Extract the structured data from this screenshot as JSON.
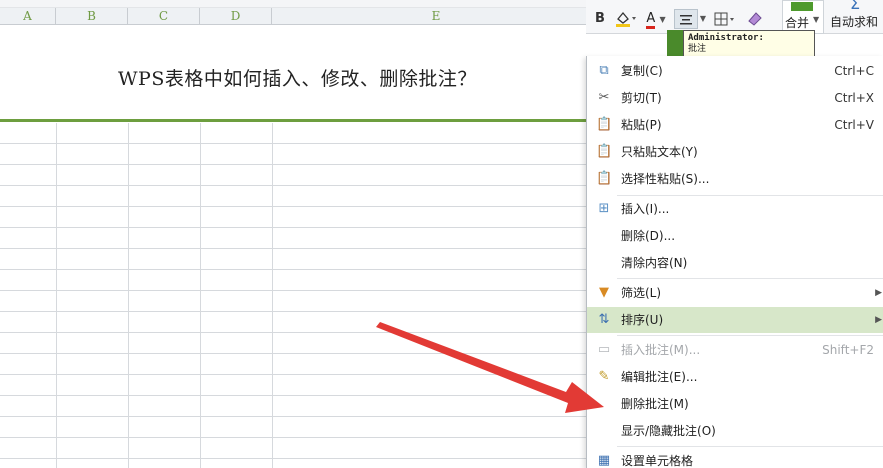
{
  "columns": [
    "A",
    "B",
    "C",
    "D",
    "E"
  ],
  "title": "WPS表格中如何插入、修改、删除批注？",
  "toolbar": {
    "bold": "B",
    "fill_icon": "fill-color-icon",
    "font_color": "A",
    "merge_label": "合并",
    "autosum_label": "自动求和"
  },
  "comment": {
    "author": "Administrator:",
    "text": "批注"
  },
  "menu": {
    "copy": {
      "label": "复制(C)",
      "shortcut": "Ctrl+C"
    },
    "cut": {
      "label": "剪切(T)",
      "shortcut": "Ctrl+X"
    },
    "paste": {
      "label": "粘贴(P)",
      "shortcut": "Ctrl+V"
    },
    "paste_text": {
      "label": "只粘贴文本(Y)"
    },
    "paste_special": {
      "label": "选择性粘贴(S)..."
    },
    "insert": {
      "label": "插入(I)..."
    },
    "delete": {
      "label": "删除(D)..."
    },
    "clear": {
      "label": "清除内容(N)"
    },
    "filter": {
      "label": "筛选(L)"
    },
    "sort": {
      "label": "排序(U)"
    },
    "insert_comment": {
      "label": "插入批注(M)...",
      "shortcut": "Shift+F2"
    },
    "edit_comment": {
      "label": "编辑批注(E)..."
    },
    "delete_comment": {
      "label": "删除批注(M)"
    },
    "toggle_comment": {
      "label": "显示/隐藏批注(O)"
    },
    "format_cells": {
      "label": "设置单元格格"
    }
  },
  "colors": {
    "accent_green": "#6d9e3f",
    "highlight": "#d7e7c9",
    "arrow_red": "#e23a35"
  }
}
